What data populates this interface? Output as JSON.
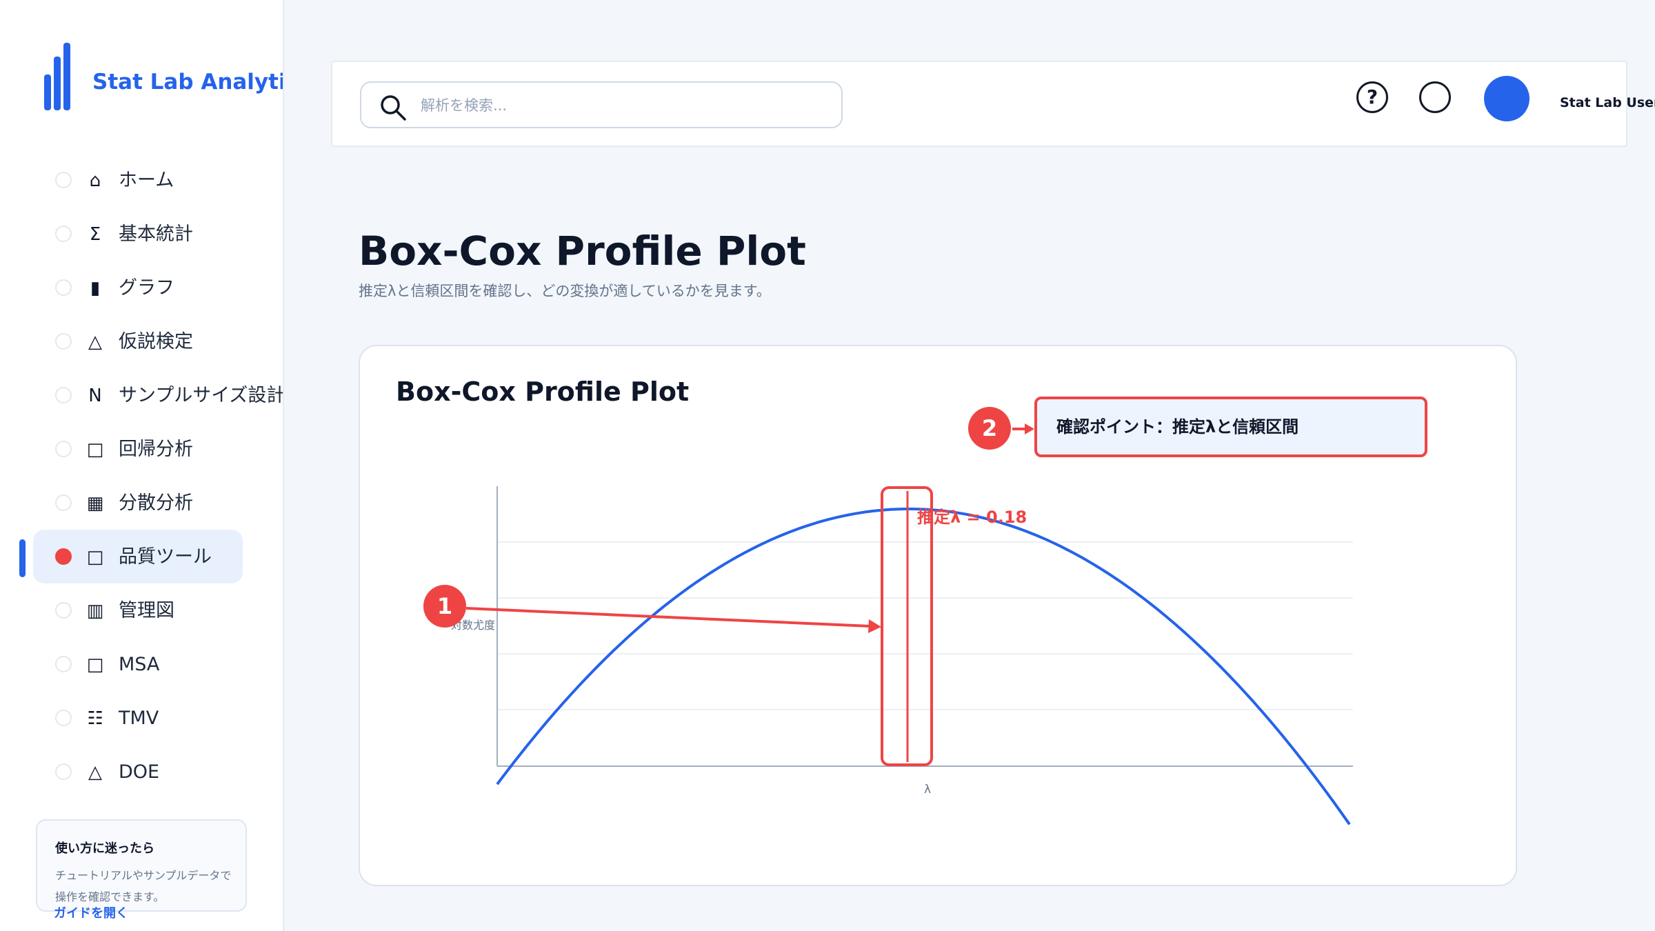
{
  "app": {
    "brand": "Stat Lab Analytics"
  },
  "sidebar": {
    "items": [
      {
        "icon": "⌂",
        "label": "ホーム"
      },
      {
        "icon": "Σ",
        "label": "基本統計"
      },
      {
        "icon": "▮",
        "label": "グラフ"
      },
      {
        "icon": "△",
        "label": "仮説検定"
      },
      {
        "icon": "N",
        "label": "サンプルサイズ設計"
      },
      {
        "icon": "□",
        "label": "回帰分析"
      },
      {
        "icon": "▦",
        "label": "分散分析"
      },
      {
        "icon": "□",
        "label": "品質ツール",
        "active": true
      },
      {
        "icon": "▥",
        "label": "管理図"
      },
      {
        "icon": "□",
        "label": "MSA"
      },
      {
        "icon": "☷",
        "label": "TMV"
      },
      {
        "icon": "△",
        "label": "DOE"
      }
    ],
    "help_card": {
      "title": "使い方に迷ったら",
      "text": "チュートリアルやサンプルデータで操作を確認できます。",
      "link": "ガイドを開く"
    }
  },
  "topbar": {
    "search_placeholder": "解析を検索...",
    "user_name": "Stat Lab User"
  },
  "page": {
    "title": "Box-Cox Profile Plot",
    "subtitle": "推定λと信頼区間を確認し、どの変換が適しているかを見ます。"
  },
  "card": {
    "title": "Box-Cox Profile Plot",
    "callout": "確認ポイント：推定λと信頼区間",
    "badge1": "1",
    "badge2": "2"
  },
  "chart_data": {
    "type": "line",
    "xlabel": "λ",
    "ylabel": "対数尤度",
    "lambda_hat": 0.18,
    "annotation": "推定λ = 0.18",
    "series": [
      {
        "color": "#2563eb",
        "shape": "concave parabola",
        "peak_x": 0.18
      }
    ]
  },
  "colors": {
    "accent": "#2563eb",
    "highlight": "#ef4444"
  }
}
